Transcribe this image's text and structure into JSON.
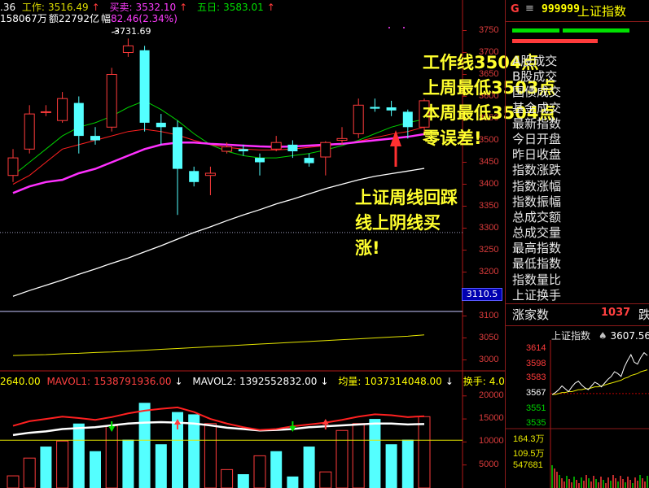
{
  "header": {
    "frag": ".36",
    "work_label": "工作:",
    "work_value": "3516.49",
    "buy_label": "买卖:",
    "buy_value": "3532.10",
    "five_label": "五日:",
    "five_value": "3583.01",
    "line2_vol": "158067万",
    "line2_amt_label": "额",
    "line2_amt": "22792亿",
    "line2_amp_label": "幅",
    "line2_amp": "82.46(2.34%)",
    "peak_label": "3731.69"
  },
  "axis": {
    "price_ticks": [
      "3750",
      "3700",
      "3650",
      "3600",
      "3550",
      "3500",
      "3450",
      "3400",
      "3350",
      "3300",
      "3250",
      "3200",
      "3150",
      "3100",
      "3050",
      "3000"
    ],
    "price_marker": "3110.5",
    "vol_ticks": [
      "20000",
      "15000",
      "10000",
      "5000"
    ]
  },
  "volume_header": {
    "vol_frag": "2640.00",
    "mavol1_label": "MAVOL1:",
    "mavol1": "1538791936.00",
    "mavol2_label": "MAVOL2:",
    "mavol2": "1392552832.00",
    "avg_label": "均量:",
    "avg": "1037314048.00",
    "turnover_label": "换手:",
    "turnover": "4.0"
  },
  "side": {
    "code": "999999",
    "name": "上证指数",
    "items": [
      "A股成交",
      "B股成交",
      "国债成交",
      "基金成交",
      "最新指数",
      "今日开盘",
      "昨日收盘",
      "指数涨跌",
      "指数涨幅",
      "指数振幅",
      "总成交额",
      "总成交量",
      "最高指数",
      "最低指数",
      "指数量比",
      "上证换手"
    ],
    "rise_label": "涨家数",
    "rise_value": "1037",
    "fall_label": "跌",
    "mini_title": "上证指数",
    "mini_price": "3607.56",
    "mini_ticks": [
      "3614",
      "3598",
      "3583",
      "3567",
      "3551",
      "3535"
    ],
    "mini_vol_ticks": [
      "164.3万",
      "109.5万",
      "547681"
    ]
  },
  "annotations": {
    "a1": "工作线3504点",
    "a2": "上周最低3503点",
    "a3": "本周最低3504点",
    "a4": "零误差!",
    "b1": "上证周线回踩",
    "b2": "线上阴线买",
    "b3": "涨!"
  },
  "chart_data": {
    "type": "candlestick",
    "ylim": [
      2975,
      3775
    ],
    "candles": [
      {
        "o": 3420,
        "c": 3460,
        "h": 3480,
        "l": 3405
      },
      {
        "o": 3480,
        "c": 3560,
        "h": 3580,
        "l": 3470
      },
      {
        "o": 3565,
        "c": 3565,
        "h": 3580,
        "l": 3555
      },
      {
        "o": 3545,
        "c": 3595,
        "h": 3610,
        "l": 3540
      },
      {
        "o": 3585,
        "c": 3510,
        "h": 3600,
        "l": 3470
      },
      {
        "o": 3510,
        "c": 3500,
        "h": 3530,
        "l": 3490
      },
      {
        "o": 3530,
        "c": 3650,
        "h": 3665,
        "l": 3520
      },
      {
        "o": 3700,
        "c": 3715,
        "h": 3731.69,
        "l": 3690
      },
      {
        "o": 3705,
        "c": 3540,
        "h": 3715,
        "l": 3520
      },
      {
        "o": 3540,
        "c": 3530,
        "h": 3560,
        "l": 3490
      },
      {
        "o": 3530,
        "c": 3435,
        "h": 3545,
        "l": 3330
      },
      {
        "o": 3430,
        "c": 3405,
        "h": 3440,
        "l": 3395
      },
      {
        "o": 3420,
        "c": 3425,
        "h": 3440,
        "l": 3375
      },
      {
        "o": 3475,
        "c": 3485,
        "h": 3495,
        "l": 3470
      },
      {
        "o": 3480,
        "c": 3475,
        "h": 3490,
        "l": 3465
      },
      {
        "o": 3460,
        "c": 3450,
        "h": 3470,
        "l": 3420
      },
      {
        "o": 3480,
        "c": 3495,
        "h": 3510,
        "l": 3475
      },
      {
        "o": 3490,
        "c": 3475,
        "h": 3500,
        "l": 3460
      },
      {
        "o": 3460,
        "c": 3448,
        "h": 3470,
        "l": 3440
      },
      {
        "o": 3462,
        "c": 3495,
        "h": 3498,
        "l": 3420
      },
      {
        "o": 3500,
        "c": 3504,
        "h": 3530,
        "l": 3490
      },
      {
        "o": 3515,
        "c": 3580,
        "h": 3595,
        "l": 3505
      },
      {
        "o": 3576,
        "c": 3572,
        "h": 3595,
        "l": 3565
      },
      {
        "o": 3575,
        "c": 3568,
        "h": 3590,
        "l": 3555
      },
      {
        "o": 3565,
        "c": 3530,
        "h": 3570,
        "l": 3504
      },
      {
        "o": 3530,
        "c": 3590,
        "h": 3595,
        "l": 3515
      }
    ],
    "ma_white": [
      3145,
      3158,
      3170,
      3182,
      3195,
      3207,
      3220,
      3232,
      3246,
      3260,
      3275,
      3290,
      3303,
      3317,
      3330,
      3342,
      3355,
      3366,
      3378,
      3390,
      3400,
      3410,
      3418,
      3424,
      3430,
      3436
    ],
    "ma_magenta": [
      3380,
      3395,
      3405,
      3410,
      3425,
      3435,
      3450,
      3465,
      3480,
      3490,
      3495,
      3495,
      3492,
      3490,
      3488,
      3486,
      3485,
      3486,
      3488,
      3490,
      3492,
      3496,
      3500,
      3504,
      3508,
      3514
    ],
    "ma_red": [
      3400,
      3420,
      3450,
      3480,
      3490,
      3500,
      3510,
      3520,
      3525,
      3520,
      3512,
      3500,
      3490,
      3484,
      3480,
      3478,
      3478,
      3480,
      3484,
      3488,
      3492,
      3498,
      3506,
      3514,
      3520,
      3530
    ],
    "ma_green": [
      3420,
      3450,
      3480,
      3510,
      3530,
      3540,
      3555,
      3575,
      3590,
      3570,
      3545,
      3515,
      3490,
      3475,
      3465,
      3460,
      3460,
      3465,
      3470,
      3478,
      3488,
      3500,
      3515,
      3530,
      3540,
      3548
    ],
    "ma_yellow_long": [
      3010,
      3011,
      3012,
      3014,
      3015,
      3017,
      3018,
      3020,
      3022,
      3024,
      3026,
      3028,
      3030,
      3032,
      3034,
      3036,
      3038,
      3040,
      3042,
      3044,
      3046,
      3048,
      3050,
      3052,
      3054,
      3057
    ],
    "volumes": [
      2640,
      6500,
      9000,
      10200,
      14000,
      8000,
      13500,
      10500,
      18500,
      9500,
      16500,
      16000,
      14000,
      4000,
      3000,
      7000,
      8000,
      2500,
      9000,
      3500,
      12500,
      14000,
      15000,
      9500,
      10500,
      15500
    ],
    "vol_up": [
      true,
      true,
      false,
      true,
      false,
      false,
      true,
      false,
      false,
      false,
      false,
      false,
      true,
      true,
      false,
      true,
      false,
      false,
      false,
      true,
      true,
      true,
      false,
      false,
      false,
      true
    ],
    "mavol_red": [
      13500,
      14500,
      15000,
      15500,
      15200,
      14800,
      15400,
      16200,
      16800,
      17200,
      17500,
      16500,
      15000,
      14000,
      13200,
      12600,
      12800,
      13400,
      13800,
      14200,
      14800,
      15500,
      16000,
      15800,
      15400,
      15600
    ],
    "mavol_white": [
      11500,
      12000,
      12300,
      12800,
      13000,
      13200,
      13600,
      14000,
      14200,
      14300,
      14200,
      14000,
      13600,
      13100,
      12800,
      12500,
      12600,
      12800,
      13200,
      13400,
      13600,
      13800,
      14000,
      14000,
      13800,
      13900
    ],
    "vol_ylim": [
      0,
      23000
    ],
    "mini_line_white": [
      3566,
      3568,
      3571,
      3575,
      3572,
      3569,
      3574,
      3578,
      3580,
      3576,
      3573,
      3571,
      3575,
      3579,
      3577,
      3574,
      3578,
      3582,
      3585,
      3590,
      3588,
      3585,
      3595,
      3602,
      3608,
      3600,
      3598,
      3605,
      3610,
      3607
    ],
    "mini_line_yellow": [
      3566,
      3566,
      3567,
      3568,
      3568,
      3569,
      3569,
      3570,
      3571,
      3571,
      3572,
      3572,
      3573,
      3574,
      3574,
      3575,
      3576,
      3577,
      3578,
      3579,
      3580,
      3581,
      3583,
      3584,
      3586,
      3587,
      3588,
      3590,
      3591,
      3592
    ],
    "mini_ylim": [
      3530,
      3620
    ]
  }
}
